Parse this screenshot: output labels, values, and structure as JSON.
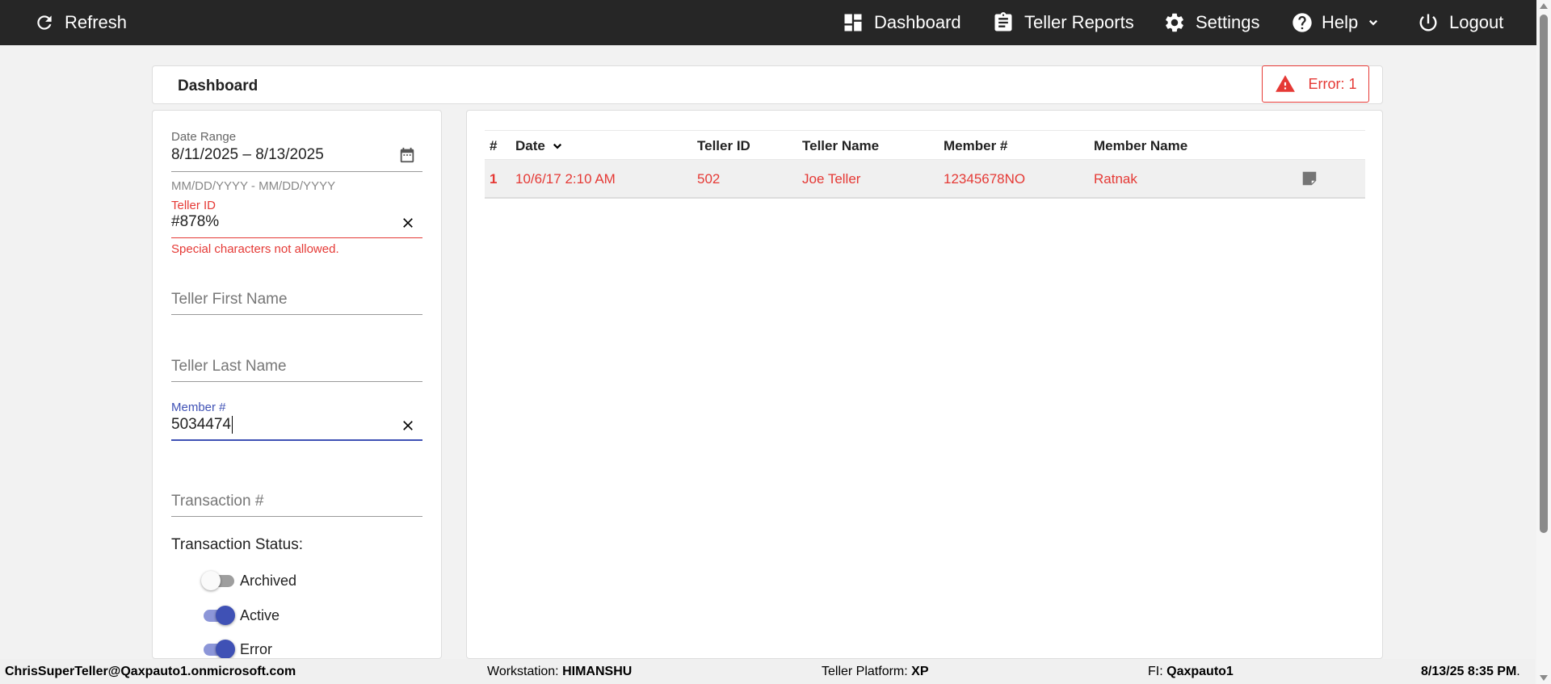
{
  "nav": {
    "refresh": "Refresh",
    "dashboard": "Dashboard",
    "teller_reports": "Teller Reports",
    "settings": "Settings",
    "help": "Help",
    "logout": "Logout"
  },
  "header": {
    "title": "Dashboard",
    "error_badge": "Error: 1"
  },
  "filters": {
    "date_range": {
      "label": "Date Range",
      "value": "8/11/2025 – 8/13/2025",
      "hint": "MM/DD/YYYY - MM/DD/YYYY"
    },
    "teller_id": {
      "label": "Teller ID",
      "value": "#878%",
      "error": "Special characters not allowed."
    },
    "teller_first_name": {
      "placeholder": "Teller First Name"
    },
    "teller_last_name": {
      "placeholder": "Teller Last Name"
    },
    "member_number": {
      "label": "Member #",
      "value": "5034474"
    },
    "transaction_number": {
      "placeholder": "Transaction #"
    },
    "status": {
      "title": "Transaction Status:",
      "options": [
        {
          "label": "Archived",
          "on": false
        },
        {
          "label": "Active",
          "on": true
        },
        {
          "label": "Error",
          "on": true
        }
      ]
    }
  },
  "table": {
    "columns": [
      "#",
      "Date",
      "Teller ID",
      "Teller Name",
      "Member #",
      "Member Name"
    ],
    "rows": [
      {
        "num": "1",
        "date": "10/6/17 2:10 AM",
        "teller_id": "502",
        "teller_name": "Joe Teller",
        "member_num": "12345678NO",
        "member_name": "Ratnak"
      }
    ]
  },
  "statusbar": {
    "user": "ChrisSuperTeller@Qaxpauto1.onmicrosoft.com",
    "workstation_label": "Workstation:",
    "workstation": "HIMANSHU",
    "platform_label": "Teller Platform:",
    "platform": "XP",
    "fi_label": "FI:",
    "fi": "Qaxpauto1",
    "datetime": "8/13/25 8:35 PM",
    "datetime_suffix": "."
  },
  "colors": {
    "nav_bg": "#262626",
    "error": "#e53935",
    "accent": "#3f51b5"
  },
  "icons": [
    "refresh-icon",
    "dashboard-icon",
    "clipboard-icon",
    "gear-icon",
    "help-icon",
    "chevron-down-icon",
    "power-icon",
    "warning-icon",
    "calendar-icon",
    "close-icon",
    "note-icon"
  ]
}
